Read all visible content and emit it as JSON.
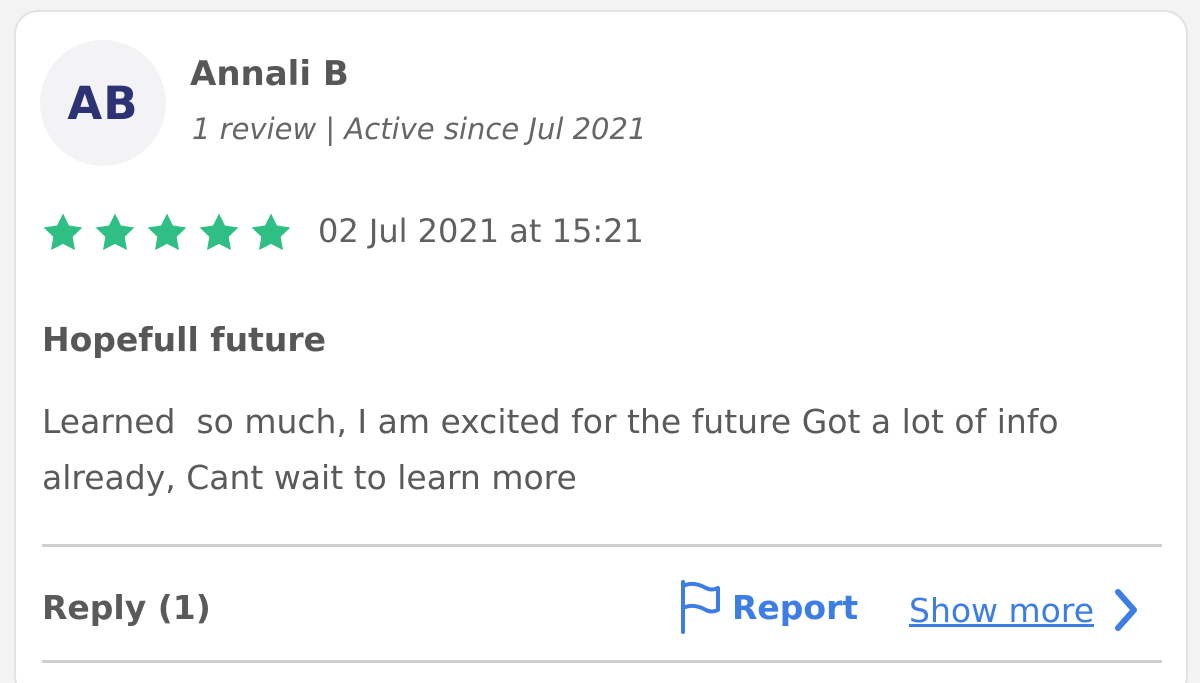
{
  "reviewer": {
    "initials": "AB",
    "name": "Annali B",
    "meta": "1 review | Active since Jul 2021"
  },
  "review": {
    "rating": 5,
    "max_rating": 5,
    "date": "02 Jul 2021 at 15:21",
    "title": "Hopefull future",
    "body": "Learned  so much, I am excited for the future Got a lot of info already, Cant wait to learn more"
  },
  "actions": {
    "reply_label": "Reply (1)",
    "report_label": "Report",
    "show_more_label": "Show more"
  },
  "colors": {
    "accent_blue": "#3c7de6",
    "star_green": "#2fbf85",
    "avatar_text": "#2c3273"
  },
  "icons": {
    "star": "star-icon",
    "report": "flag-icon",
    "show_more": "chevron-right-icon"
  }
}
